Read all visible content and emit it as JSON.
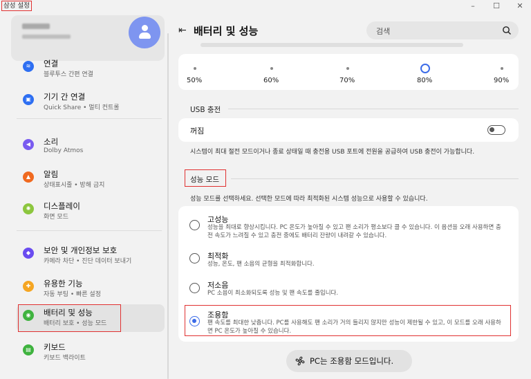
{
  "window": {
    "app_title": "삼성 설정",
    "controls": {
      "minimize": "–",
      "maximize": "☐",
      "close": "✕"
    }
  },
  "sidebar": {
    "items": [
      {
        "label": "연결",
        "sub": "블루투스 간편 연결",
        "icon": "wifi-icon",
        "color": "#2e6ff2",
        "glyph": "≋"
      },
      {
        "label": "기기 간 연결",
        "sub": "Quick Share  •  멀티 컨트롤",
        "icon": "devices-icon",
        "color": "#2e6ff2",
        "glyph": "▣"
      },
      {
        "label": "소리",
        "sub": "Dolby Atmos",
        "icon": "sound-icon",
        "color": "#7a5cf0",
        "glyph": "◀"
      },
      {
        "label": "알림",
        "sub": "상태표시줄 • 방해 금지",
        "icon": "notification-icon",
        "color": "#f06a20",
        "glyph": "▲"
      },
      {
        "label": "디스플레이",
        "sub": "화면 모드",
        "icon": "display-icon",
        "color": "#8cc63e",
        "glyph": "✺"
      },
      {
        "label": "보안 및 개인정보 보호",
        "sub": "카메라 차단  •  진단 데이터 보내기",
        "icon": "security-icon",
        "color": "#6a4cf0",
        "glyph": "◆"
      },
      {
        "label": "유용한 기능",
        "sub": "자동 부팅  •  빠른 설정",
        "icon": "useful-features-icon",
        "color": "#f5a623",
        "glyph": "✚"
      },
      {
        "label": "배터리 및 성능",
        "sub": "배터리 보호  •  성능 모드",
        "icon": "battery-icon",
        "color": "#3fb33f",
        "glyph": "◉"
      },
      {
        "label": "키보드",
        "sub": "키보드 백라이트",
        "icon": "keyboard-icon",
        "color": "#3fb33f",
        "glyph": "▤"
      }
    ]
  },
  "header": {
    "title": "배터리 및 성능",
    "search_placeholder": "검색"
  },
  "charge_limit": {
    "ticks": [
      "50%",
      "60%",
      "70%",
      "80%",
      "90%"
    ],
    "selected": "80%",
    "selected_index": 3
  },
  "usb": {
    "section_title": "USB 충전",
    "row_label": "꺼짐",
    "toggle_on": false,
    "description": "시스템이 최대 절전 모드이거나 종료 상태일 때 충전용 USB 포트에 전원을 공급하여 USB 충전이 가능합니다."
  },
  "performance": {
    "section_title": "성능 모드",
    "description": "성능 모드를 선택하세요. 선택한 모드에 따라 최적화된 시스템 성능으로 사용할 수 있습니다.",
    "options": [
      {
        "title": "고성능",
        "desc": "성능을 최대로 향상시킵니다. PC 온도가 높아질 수 있고 팬 소리가 평소보다 클 수 있습니다. 이 옵션을 오래 사용하면 충전 속도가 느려질 수 있고 충전 중에도 배터리 잔량이 내려갈 수 있습니다.",
        "selected": false
      },
      {
        "title": "최적화",
        "desc": "성능, 온도, 팬 소음의 균형을 최적화합니다.",
        "selected": false
      },
      {
        "title": "저소음",
        "desc": "PC 소음이 최소화되도록 성능 및 팬 속도를 줄입니다.",
        "selected": false
      },
      {
        "title": "조용함",
        "desc": "팬 속도를 최대한 낮춥니다. PC를 사용해도 팬 소리가 거의 들리지 않지만 성능이 제한될 수 있고, 이 모드를 오래 사용하면 PC 온도가 높아질 수 있습니다.",
        "selected": true
      }
    ]
  },
  "toast": {
    "text": "PC는 조용함 모드입니다.",
    "icon": "fan-icon"
  },
  "colors": {
    "accent": "#3b6be8",
    "highlight": "#e03030"
  }
}
